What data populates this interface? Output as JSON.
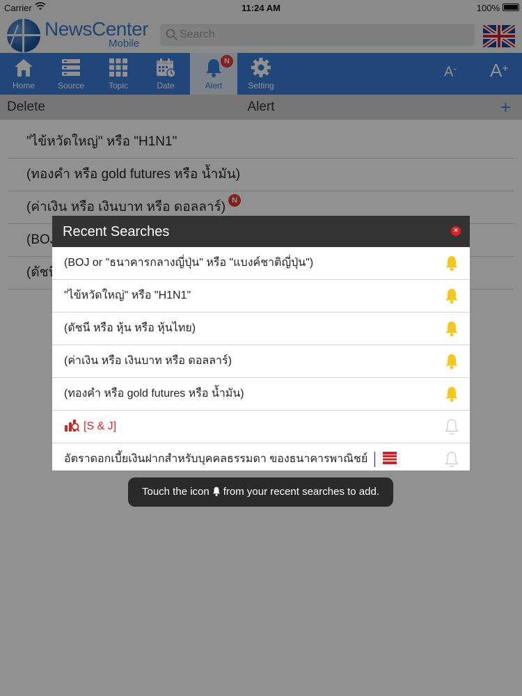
{
  "status": {
    "carrier": "Carrier",
    "time": "11:24 AM",
    "battery": "100%"
  },
  "header": {
    "app_name": "NewsCenter",
    "app_sub": "Mobile",
    "search_placeholder": "Search"
  },
  "toolbar": {
    "items": [
      {
        "label": "Home",
        "icon": "home-icon"
      },
      {
        "label": "Source",
        "icon": "source-icon"
      },
      {
        "label": "Topic",
        "icon": "grid-icon"
      },
      {
        "label": "Date",
        "icon": "calendar-icon"
      },
      {
        "label": "Alert",
        "icon": "bell-icon",
        "badge": "N",
        "active": true
      },
      {
        "label": "Setting",
        "icon": "gear-icon"
      }
    ],
    "font_decrease": "A",
    "font_decrease_sup": "-",
    "font_increase": "A",
    "font_increase_sup": "+"
  },
  "titlebar": {
    "delete_label": "Delete",
    "title": "Alert",
    "add_label": "+"
  },
  "alerts": [
    {
      "text": "\"ไข้หวัดใหญ่\" หรือ \"H1N1\""
    },
    {
      "text": "(ทองคำ หรือ gold futures หรือ น้ำมัน)"
    },
    {
      "text": "(ค่าเงิน หรือ เงินบาท หรือ ดอลลาร์)",
      "badge": "N"
    },
    {
      "text": "(BOJ"
    },
    {
      "text": "(ดัชนี"
    }
  ],
  "popup": {
    "title": "Recent Searches",
    "close": "×",
    "items": [
      {
        "text": "(BOJ or \"ธนาคารกลางญี่ปุ่น\" หรือ \"แบงค์ชาติญี่ปุ่น\")",
        "bell": "filled"
      },
      {
        "text": "\"ไข้หวัดใหญ่\" หรือ \"H1N1\"",
        "bell": "filled"
      },
      {
        "text": "(ดัชนี หรือ หุ้น หรือ หุ้นไทย)",
        "bell": "filled"
      },
      {
        "text": "(ค่าเงิน หรือ เงินบาท หรือ ดอลลาร์)",
        "bell": "filled"
      },
      {
        "text": "(ทองคำ หรือ gold futures หรือ น้ำมัน)",
        "bell": "filled"
      },
      {
        "text": "[S & J]",
        "bell": "outline",
        "icon": "stock-chart-icon"
      },
      {
        "text": "อัตราดอกเบี้ยเงินฝากสำหรับบุคคลธรรมดา ของธนาคารพาณิชย์",
        "bell": "outline",
        "icon": "document-list-icon"
      }
    ]
  },
  "toast": {
    "before": "Touch the icon",
    "after": "from your recent searches to add."
  },
  "colors": {
    "toolbar_blue": "#3a7bd5",
    "bell_yellow": "#f2c81d",
    "badge_red": "#e53935",
    "stock_red": "#c62828"
  }
}
